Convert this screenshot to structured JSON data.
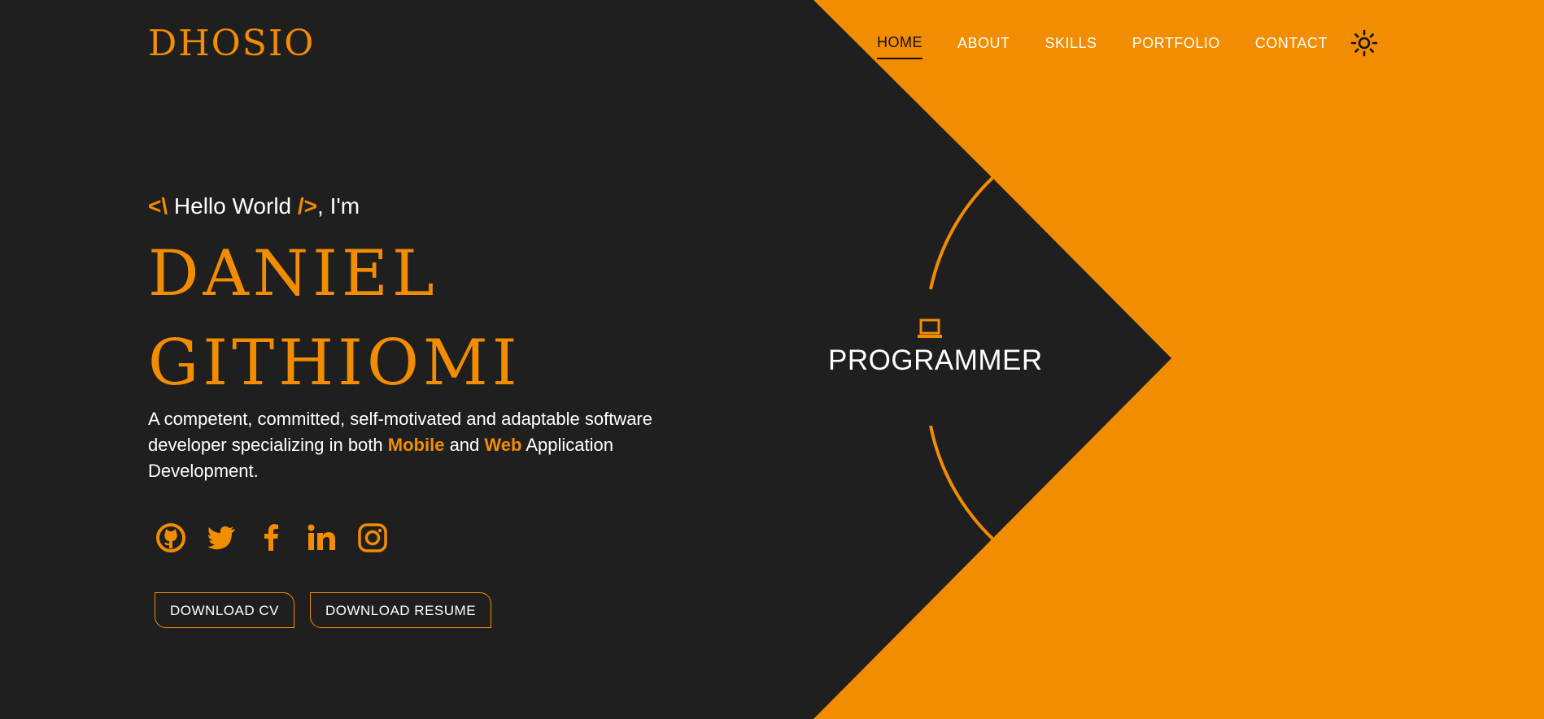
{
  "brand": {
    "logo": "DHOSIO",
    "accent_color": "#f28c00",
    "background_color": "#1f1f1f"
  },
  "nav": {
    "items": [
      {
        "label": "HOME",
        "active": true
      },
      {
        "label": "ABOUT",
        "active": false
      },
      {
        "label": "SKILLS",
        "active": false
      },
      {
        "label": "PORTFOLIO",
        "active": false
      },
      {
        "label": "CONTACT",
        "active": false
      }
    ],
    "theme_toggle_icon": "sun-icon"
  },
  "hero": {
    "greeting_open": "<\\",
    "greeting_text": "Hello World",
    "greeting_close": "/>",
    "greeting_suffix": ", I'm",
    "name_line1": "DANIEL",
    "name_line2": "GITHIOMI",
    "description_before": "A competent, committed, self-motivated and adaptable software developer specializing in both",
    "description_highlight1": "Mobile",
    "description_middle": "and",
    "description_highlight2": "Web",
    "description_after": "Application Development.",
    "role": "PROGRAMMER",
    "role_icon": "laptop-icon"
  },
  "socials": [
    {
      "name": "github-icon"
    },
    {
      "name": "twitter-icon"
    },
    {
      "name": "facebook-icon"
    },
    {
      "name": "linkedin-icon"
    },
    {
      "name": "instagram-icon"
    }
  ],
  "buttons": {
    "download_cv": "DOWNLOAD CV",
    "download_resume": "DOWNLOAD RESUME"
  }
}
